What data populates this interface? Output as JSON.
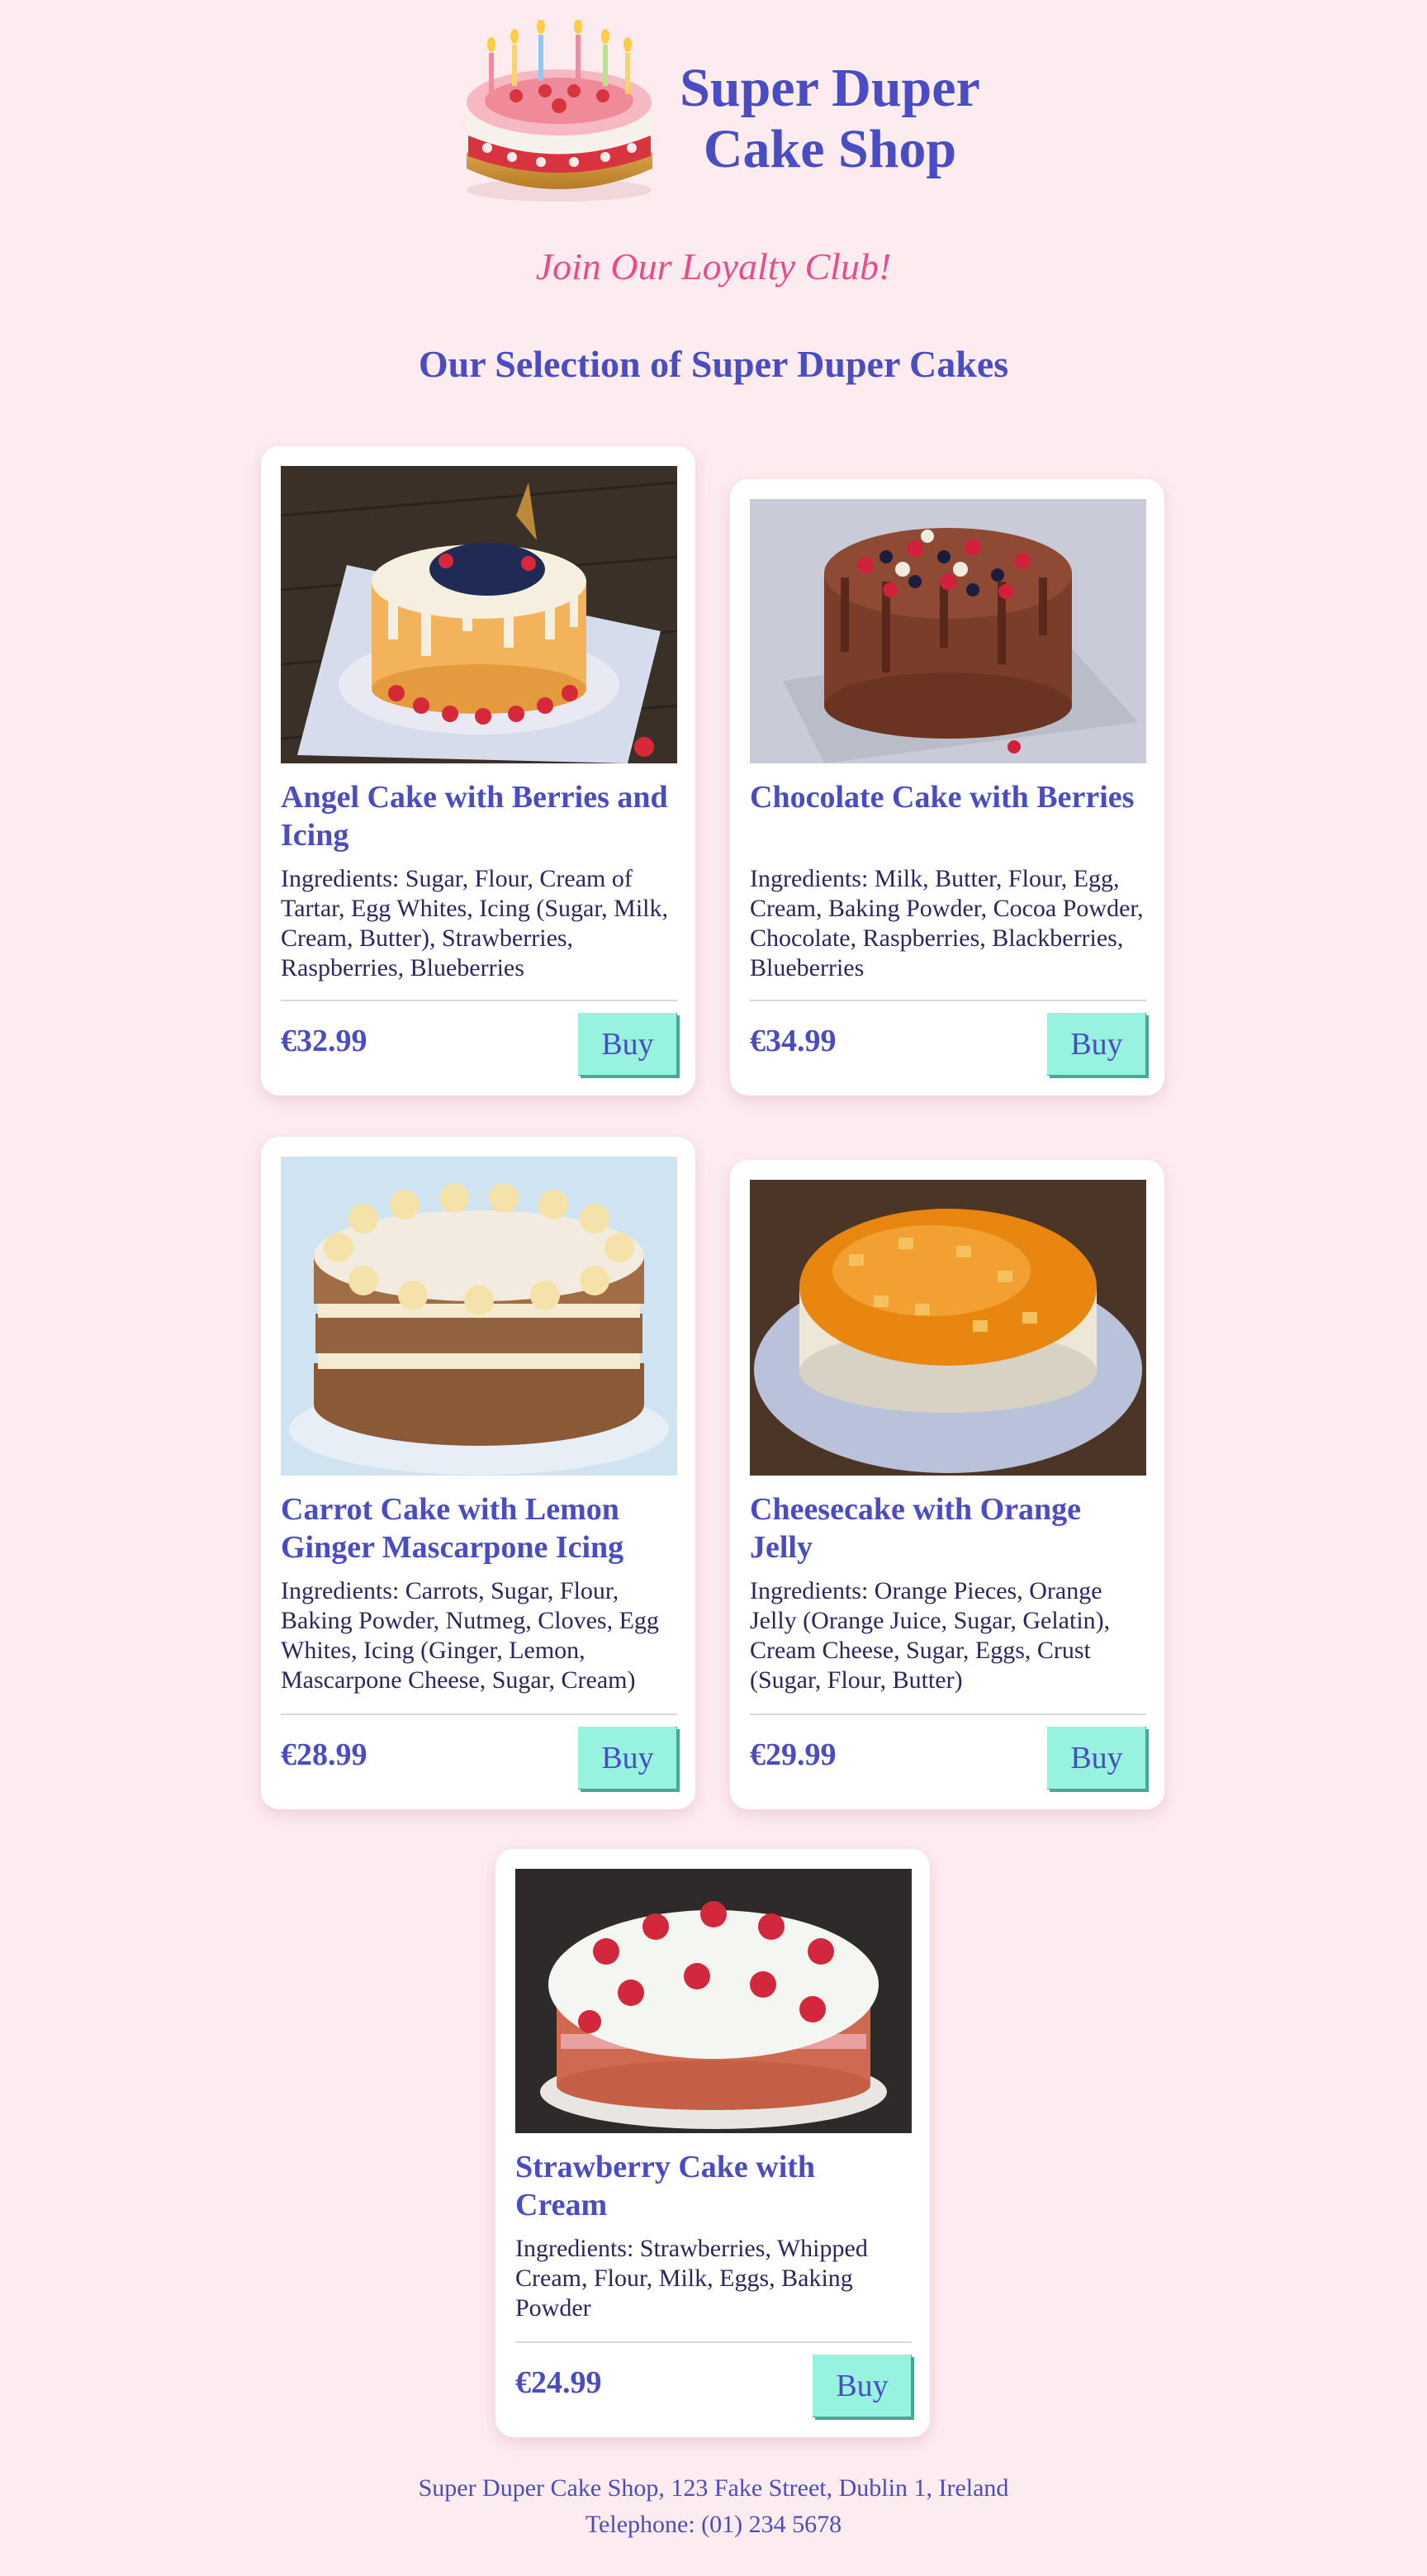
{
  "header": {
    "logo_icon": "birthday-cake-icon",
    "title_line1": "Super Duper",
    "title_line2": "Cake Shop"
  },
  "loyalty_link": "Join Our Loyalty Club!",
  "section_title": "Our Selection of Super Duper Cakes",
  "cakes": [
    {
      "title": "Angel Cake with Berries and Icing",
      "ingredients": "Ingredients: Sugar, Flour, Cream of Tartar, Egg Whites, Icing (Sugar, Milk, Cream, Butter), Strawberries, Raspberries, Blueberries",
      "price": "€32.99",
      "buy_label": "Buy"
    },
    {
      "title": "Chocolate Cake with Berries",
      "ingredients": "Ingredients: Milk, Butter, Flour, Egg, Cream, Baking Powder, Cocoa Powder, Chocolate, Raspberries, Blackberries, Blueberries",
      "price": "€34.99",
      "buy_label": "Buy"
    },
    {
      "title": "Carrot Cake with Lemon Ginger Mascarpone Icing",
      "ingredients": "Ingredients: Carrots, Sugar, Flour, Baking Powder, Nutmeg, Cloves, Egg Whites, Icing (Ginger, Lemon, Mascarpone Cheese, Sugar, Cream)",
      "price": "€28.99",
      "buy_label": "Buy"
    },
    {
      "title": "Cheesecake with Orange Jelly",
      "ingredients": "Ingredients: Orange Pieces, Orange Jelly (Orange Juice, Sugar, Gelatin), Cream Cheese, Sugar, Eggs, Crust (Sugar, Flour, Butter)",
      "price": "€29.99",
      "buy_label": "Buy"
    },
    {
      "title": "Strawberry Cake with Cream",
      "ingredients": "Ingredients: Strawberries, Whipped Cream, Flour, Milk, Eggs, Baking Powder",
      "price": "€24.99",
      "buy_label": "Buy"
    }
  ],
  "footer": {
    "address": "Super Duper Cake Shop, 123 Fake Street, Dublin 1, Ireland",
    "telephone": "Telephone: (01) 234 5678"
  },
  "colors": {
    "background": "#fdecef",
    "heading": "#4a4cc4",
    "loyalty": "#ea4c8b",
    "buy_button": "#98f2e0"
  }
}
